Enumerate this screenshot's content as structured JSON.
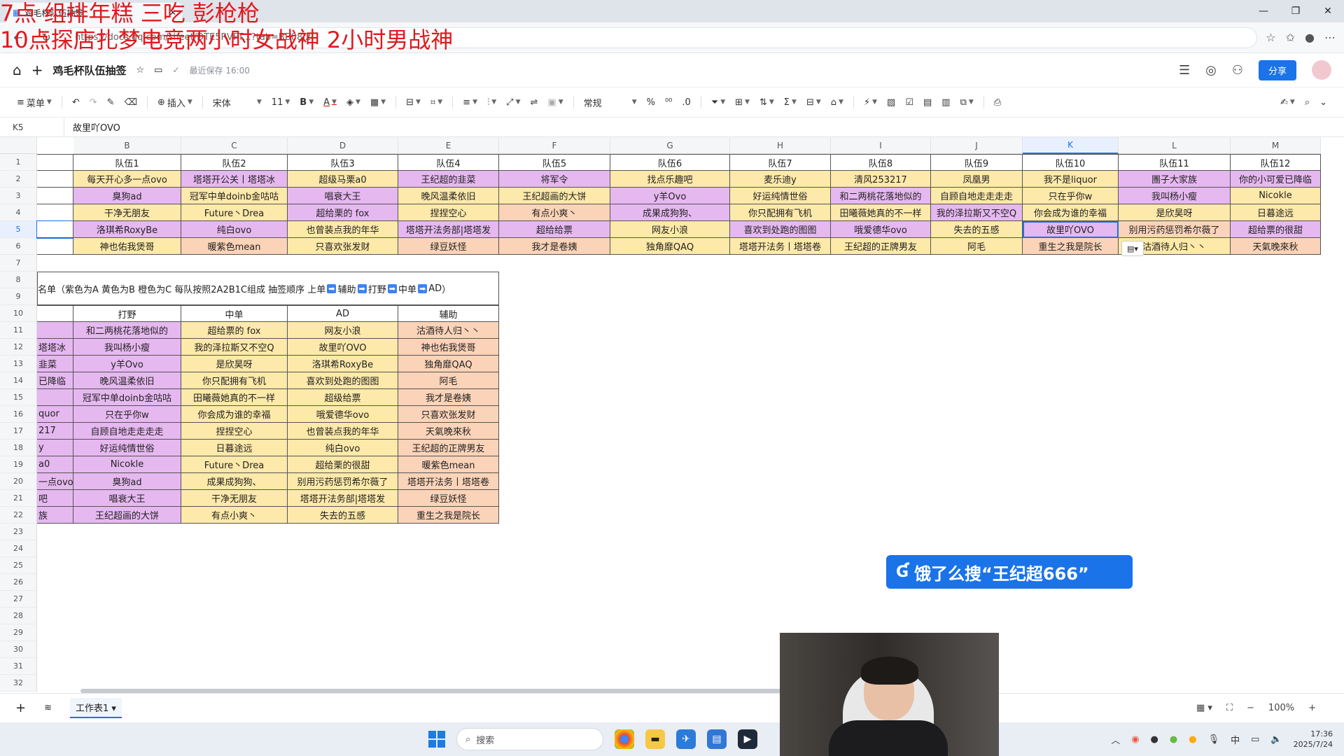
{
  "overlay": {
    "line1": "7点 组排年糕 三吃 彭枪枪",
    "line2": "10点探店扎梦电竞两小时女战神 2小时男战神"
  },
  "browser": {
    "tab_title": "鸡毛杯队伍抽签",
    "url": "https://docs.qq.com/sheet/DTE5RVFT...?tab=BB08J2"
  },
  "app": {
    "doc_title": "鸡毛杯队伍抽签",
    "save_status": "最近保存 16:00",
    "share_label": "分享"
  },
  "toolbar": {
    "menu": "菜单",
    "insert": "插入",
    "font": "宋体",
    "size": "11",
    "number_format": "常规",
    "percent": "%",
    "decimal": ".0"
  },
  "formula": {
    "cell_ref": "K5",
    "value": "故里吖OVO"
  },
  "columns": [
    "B",
    "C",
    "D",
    "E",
    "F",
    "G",
    "H",
    "I",
    "J",
    "K",
    "L",
    "M"
  ],
  "teams": {
    "header": [
      "队伍1",
      "队伍2",
      "队伍3",
      "队伍4",
      "队伍5",
      "队伍6",
      "队伍7",
      "队伍8",
      "队伍9",
      "队伍10",
      "队伍11",
      "队伍12"
    ],
    "rows": [
      [
        "每天开心多一点ovo",
        "塔塔开公关丨塔塔冰",
        "超级马栗a0",
        "王纪超的韭菜",
        "将军令",
        "找点乐趣吧",
        "麦乐迪y",
        "清风253217",
        "凤凰男",
        "我不是liquor",
        "團子大家族",
        "你的小可爱已降临"
      ],
      [
        "臭狗ad",
        "冠军中单doinb金咕咕",
        "唱衰大王",
        "晚风温柔依旧",
        "王纪超画的大饼",
        "y羊Ovo",
        "好运纯情世俗",
        "和二两桃花落地似的",
        "自顾自地走走走走",
        "只在乎你w",
        "我叫杨小瘦",
        "Nicokle"
      ],
      [
        "干净无朋友",
        "Future丶Drea",
        "超给栗的 fox",
        "捏捏空心",
        "有点小爽丶",
        "成果成狗狗、",
        "你只配拥有飞机",
        "田曦薇她真的不一样",
        "我的泽拉斯又不空Q",
        "你会成为谁的幸福",
        "是欣昊呀",
        "日暮途远"
      ],
      [
        "洛琪希RoxyBe",
        "纯白ovo",
        "也曾装点我的年华",
        "塔塔开法务部|塔塔发",
        "超给给票",
        "网友小浪",
        "喜欢到处跑的图图",
        "哦爱德华ovo",
        "失去的五感",
        "故里吖OVO",
        "别用污药惩罚希尔薇了",
        "超给票的很甜"
      ],
      [
        "神也佑我煲哥",
        "暖紫色mean",
        "只喜欢张发财",
        "绿豆妖怪",
        "我才是卷姨",
        "独角靡QAQ",
        "塔塔开法务丨塔塔卷",
        "王纪超的正牌男友",
        "阿毛",
        "重生之我是院长",
        "沽酒待人归丶丶",
        "天氣晚來秋"
      ]
    ],
    "row_colors": [
      [
        "#fde9a9",
        "#e6b8f0",
        "#fde9a9",
        "#e6b8f0",
        "#e6b8f0",
        "#fde9a9",
        "#fde9a9",
        "#fde9a9",
        "#fde9a9",
        "#fde9a9",
        "#e6b8f0",
        "#e6b8f0"
      ],
      [
        "#e6b8f0",
        "#fde9a9",
        "#e6b8f0",
        "#fde9a9",
        "#fde9a9",
        "#e6b8f0",
        "#fde9a9",
        "#e6b8f0",
        "#fde9a9",
        "#fde9a9",
        "#e6b8f0",
        "#fde9a9"
      ],
      [
        "#fde9a9",
        "#fde9a9",
        "#e6b8f0",
        "#fde9a9",
        "#fbd3b8",
        "#e6b8f0",
        "#fde9a9",
        "#fde9a9",
        "#e6b8f0",
        "#fde9a9",
        "#fde9a9",
        "#fde9a9"
      ],
      [
        "#e6b8f0",
        "#e6b8f0",
        "#fde9a9",
        "#e6b8f0",
        "#e6b8f0",
        "#fde9a9",
        "#e6b8f0",
        "#e6b8f0",
        "#fde9a9",
        "#e6b8f0",
        "#fbd3b8",
        "#e6b8f0"
      ],
      [
        "#fde9a9",
        "#fbd3b8",
        "#fde9a9",
        "#fbd3b8",
        "#fbd3b8",
        "#fde9a9",
        "#fde9a9",
        "#fde9a9",
        "#fde9a9",
        "#fbd3b8",
        "#fde9a9",
        "#fbd3b8"
      ]
    ]
  },
  "notice": {
    "text_a": "名单（紫色为A 黄色为B 橙色为C 每队按照2A2B1C组成 抽签顺序 上单",
    "s1": "辅助",
    "s2": "打野",
    "s3": "中单",
    "s4": "AD",
    "end": "）"
  },
  "roles": {
    "header": [
      "打野",
      "中单",
      "AD",
      "辅助"
    ],
    "col_a_frag": [
      "",
      "塔塔冰",
      "韭菜",
      "已降临",
      "",
      "quor",
      "217",
      "y",
      "a0",
      "一点ovo",
      "吧",
      "族"
    ],
    "rows": [
      [
        "和二两桃花落地似的",
        "超给票的 fox",
        "网友小浪",
        "沽酒待人归丶丶"
      ],
      [
        "我叫杨小瘦",
        "我的泽拉斯又不空Q",
        "故里吖OVO",
        "神也佑我煲哥"
      ],
      [
        "y羊Ovo",
        "是欣昊呀",
        "洛琪希RoxyBe",
        "独角靡QAQ"
      ],
      [
        "晚风温柔依旧",
        "你只配拥有飞机",
        "喜欢到处跑的图图",
        "阿毛"
      ],
      [
        "冠军中单doinb金咕咕",
        "田曦薇她真的不一样",
        "超级给票",
        "我才是卷姨"
      ],
      [
        "只在乎你w",
        "你会成为谁的幸福",
        "哦爱德华ovo",
        "只喜欢张发财"
      ],
      [
        "自顾自地走走走走",
        "捏捏空心",
        "也曾装点我的年华",
        "天氣晚來秋"
      ],
      [
        "好运纯情世俗",
        "日暮途远",
        "纯白ovo",
        "王纪超的正牌男友"
      ],
      [
        "Nicokle",
        "Future丶Drea",
        "超给栗的很甜",
        "暖紫色mean"
      ],
      [
        "臭狗ad",
        "成果成狗狗、",
        "别用污药惩罚希尔薇了",
        "塔塔开法务丨塔塔卷"
      ],
      [
        "唱衰大王",
        "干净无朋友",
        "塔塔开法务部|塔塔发",
        "绿豆妖怪"
      ],
      [
        "王纪超画的大饼",
        "有点小爽丶",
        "失去的五感",
        "重生之我是院长"
      ]
    ],
    "colors": [
      "#e6b8f0",
      "#e6b8f0",
      "#fde9a9",
      "#fde9a9",
      "#fbd3b8"
    ]
  },
  "sheet_tab": "工作表1",
  "zoom": "100%",
  "banner": "饿了么搜“王纪超666”",
  "taskbar": {
    "search": "搜索",
    "time": "17:36",
    "date": "2025/7/24",
    "ime": "中"
  }
}
